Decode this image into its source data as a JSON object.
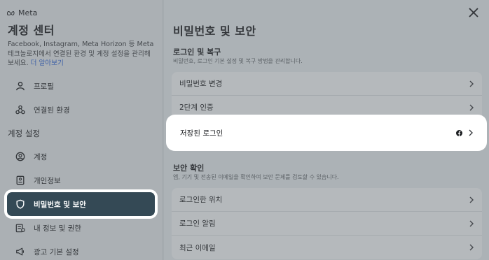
{
  "brand": {
    "logo_text": "Meta"
  },
  "sidebar": {
    "title": "계정 센터",
    "description": "Facebook, Instagram, Meta Horizon 등 Meta 테크놀로지에서 연결된 환경 및 계정 설정을 관리해보세요.",
    "learn_more": "더 알아보기",
    "items_top": [
      {
        "label": "프로필",
        "icon": "person-icon"
      },
      {
        "label": "연결된 환경",
        "icon": "connected-icon"
      }
    ],
    "section_label": "계정 설정",
    "items_settings": [
      {
        "label": "계정",
        "icon": "account-icon"
      },
      {
        "label": "개인정보",
        "icon": "id-card-icon"
      },
      {
        "label": "비밀번호 및 보안",
        "icon": "shield-icon",
        "active": true
      },
      {
        "label": "내 정보 및 권한",
        "icon": "info-icon"
      },
      {
        "label": "광고 기본 설정",
        "icon": "megaphone-icon"
      }
    ]
  },
  "main": {
    "title": "비밀번호 및 보안",
    "login_section": {
      "title": "로그인 및 복구",
      "subtitle": "비밀번호, 로그인 기본 설정 및 복구 방법을 관리합니다.",
      "rows": [
        "비밀번호 변경",
        "2단계 인증",
        "저장된 로그인"
      ]
    },
    "security_section": {
      "title": "보안 확인",
      "subtitle": "앱, 기기 및 전송된 이메일을 확인하여 보안 문제를 검토할 수 있습니다.",
      "rows": [
        "로그인한 위치",
        "로그인 알림",
        "최근 이메일"
      ]
    }
  },
  "colors": {
    "active_bg": "#344955",
    "link": "#2b5fcf",
    "highlight": "#ffffff"
  }
}
